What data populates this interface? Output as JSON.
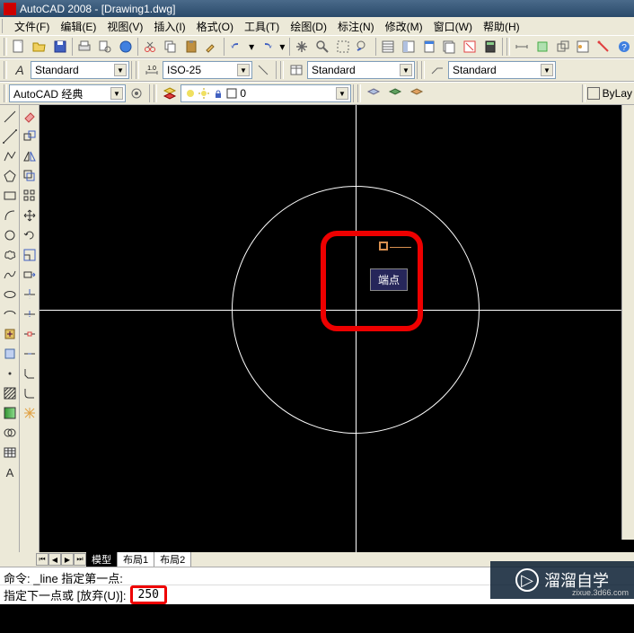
{
  "title": "AutoCAD 2008 - [Drawing1.dwg]",
  "menu": {
    "file": "文件(F)",
    "edit": "编辑(E)",
    "view": "视图(V)",
    "insert": "插入(I)",
    "format": "格式(O)",
    "tools": "工具(T)",
    "draw": "绘图(D)",
    "dimension": "标注(N)",
    "modify": "修改(M)",
    "window": "窗口(W)",
    "help": "帮助(H)"
  },
  "styles": {
    "text_style": "Standard",
    "dim_style": "ISO-25",
    "table_style": "Standard",
    "mleader_style": "Standard",
    "workspace": "AutoCAD 经典",
    "layer_display": "0",
    "bylayer": "ByLay"
  },
  "snap_tooltip": "端点",
  "tabs": {
    "model": "模型",
    "layout1": "布局1",
    "layout2": "布局2"
  },
  "command": {
    "log": "命令: _line 指定第一点:",
    "prompt": "指定下一点或 [放弃(U)]:",
    "value": "250"
  },
  "watermark": {
    "text": "溜溜自学",
    "url": "zixue.3d66.com"
  },
  "icons": {
    "new": "new-file-icon",
    "open": "open-file-icon",
    "save": "save-icon",
    "plot": "plot-icon",
    "preview": "print-preview-icon",
    "publish": "publish-icon",
    "cut": "cut-icon",
    "copy": "copy-icon",
    "paste": "paste-icon",
    "match": "match-prop-icon",
    "undo": "undo-icon",
    "redo": "redo-icon",
    "pan": "pan-icon",
    "zoom": "zoom-icon",
    "zoomprev": "zoom-prev-icon",
    "props": "properties-icon",
    "dcenter": "design-center-icon",
    "tpal": "tool-palette-icon",
    "sheetset": "sheet-set-icon",
    "markup": "markup-icon",
    "calc": "calculator-icon",
    "help": "help-icon",
    "line": "line-icon",
    "xline": "xline-icon",
    "pline": "polyline-icon",
    "polygon": "polygon-icon",
    "rect": "rectangle-icon",
    "arc": "arc-icon",
    "circle": "circle-icon",
    "revcloud": "revcloud-icon",
    "spline": "spline-icon",
    "ellipse": "ellipse-icon",
    "ellipsearc": "ellipse-arc-icon",
    "block": "insert-block-icon",
    "mkblock": "make-block-icon",
    "point": "point-icon",
    "hatch": "hatch-icon",
    "gradient": "gradient-icon",
    "region": "region-icon",
    "table": "table-icon",
    "mtext": "mtext-icon",
    "addsel": "add-selected-icon"
  }
}
